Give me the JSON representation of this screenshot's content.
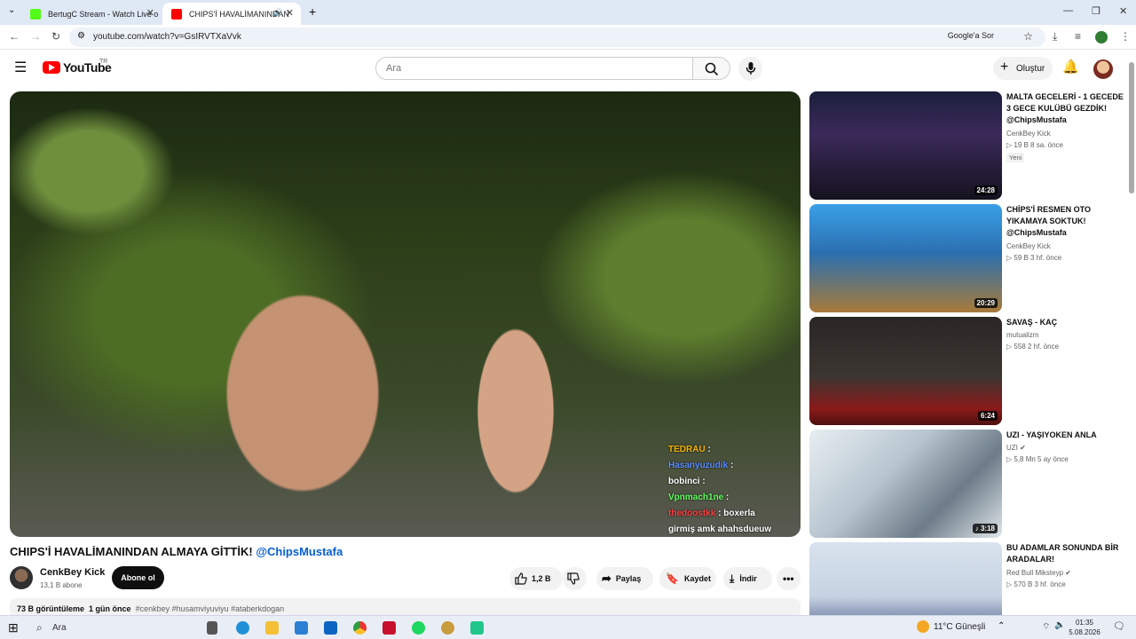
{
  "browser": {
    "tabs": [
      {
        "title": "BertugC Stream - Watch Live o",
        "favicon_color": "#53fc18"
      },
      {
        "title": "CHIPS'İ HAVALİMANINDAN",
        "favicon_color": "#ff0000"
      }
    ],
    "new_tab": "+",
    "url": "youtube.com/watch?v=GsIRVTXaVvk",
    "ask_google": "Google'a Sor"
  },
  "youtube": {
    "logo_text": "YouTube",
    "region": "TR",
    "search_placeholder": "Ara",
    "create_label": "Oluştur"
  },
  "video": {
    "chat": [
      {
        "user": "TEDRAU",
        "msg": ":",
        "color": "#f5b400"
      },
      {
        "user": "Hasanyuzudik",
        "msg": ":",
        "color": "#5a8cff"
      },
      {
        "user": "bobinci",
        "msg": ":",
        "color": "#ffffff"
      },
      {
        "user": "Vpnmach1ne",
        "msg": ":",
        "color": "#60ff60"
      },
      {
        "user": "thedoostkk",
        "msg": ": boxerla",
        "color": "#ff4040"
      },
      {
        "user": "",
        "msg": "girmiş amk ahahsdueuw",
        "color": "#ffffff"
      }
    ],
    "title_main": "CHIPS'İ HAVALİMANINDAN ALMAYA GİTTİK!",
    "title_tag": "@ChipsMustafa",
    "channel": "CenkBey Kick",
    "subscribers": "13,1 B abone",
    "subscribe_label": "Abone ol",
    "likes": "1,2 B",
    "share_label": "Paylaş",
    "save_label": "Kaydet",
    "download_label": "İndir",
    "views": "73 B görüntüleme",
    "age": "1 gün önce",
    "hashtags": "#cenkbey #husamviyuviyu #ataberkdogan"
  },
  "recommendations": [
    {
      "title": "MALTA GECELERİ - 1 GECEDE 3 GECE KULÜBÜ GEZDİK! @ChipsMustafa",
      "channel": "CenkBey Kick",
      "meta": "19 B  8 sa. önce",
      "badge": "Yeni",
      "duration": "24:28"
    },
    {
      "title": "CHİPS'İ RESMEN OTO YIKAMAYA SOKTUK! @ChipsMustafa",
      "channel": "CenkBey Kick",
      "meta": "59 B  3 hf. önce",
      "duration": "20:29"
    },
    {
      "title": "SAVAŞ - KAÇ",
      "channel": "mutualizm",
      "meta": "558  2 hf. önce",
      "duration": "6:24"
    },
    {
      "title": "UZI - YAŞIYOKEN ANLA",
      "channel": "UZI",
      "meta": "5,8 Mn  5 ay önce",
      "duration": "3:18"
    },
    {
      "title": "BU ADAMLAR SONUNDA BİR ARADALAR!",
      "channel": "Red Bull Miksteyp",
      "meta": "570 B  3 hf. önce",
      "duration": ""
    }
  ],
  "taskbar": {
    "search_placeholder": "Ara",
    "weather": "11°C  Güneşli",
    "time": "01:35",
    "date": "5.08.2026"
  }
}
